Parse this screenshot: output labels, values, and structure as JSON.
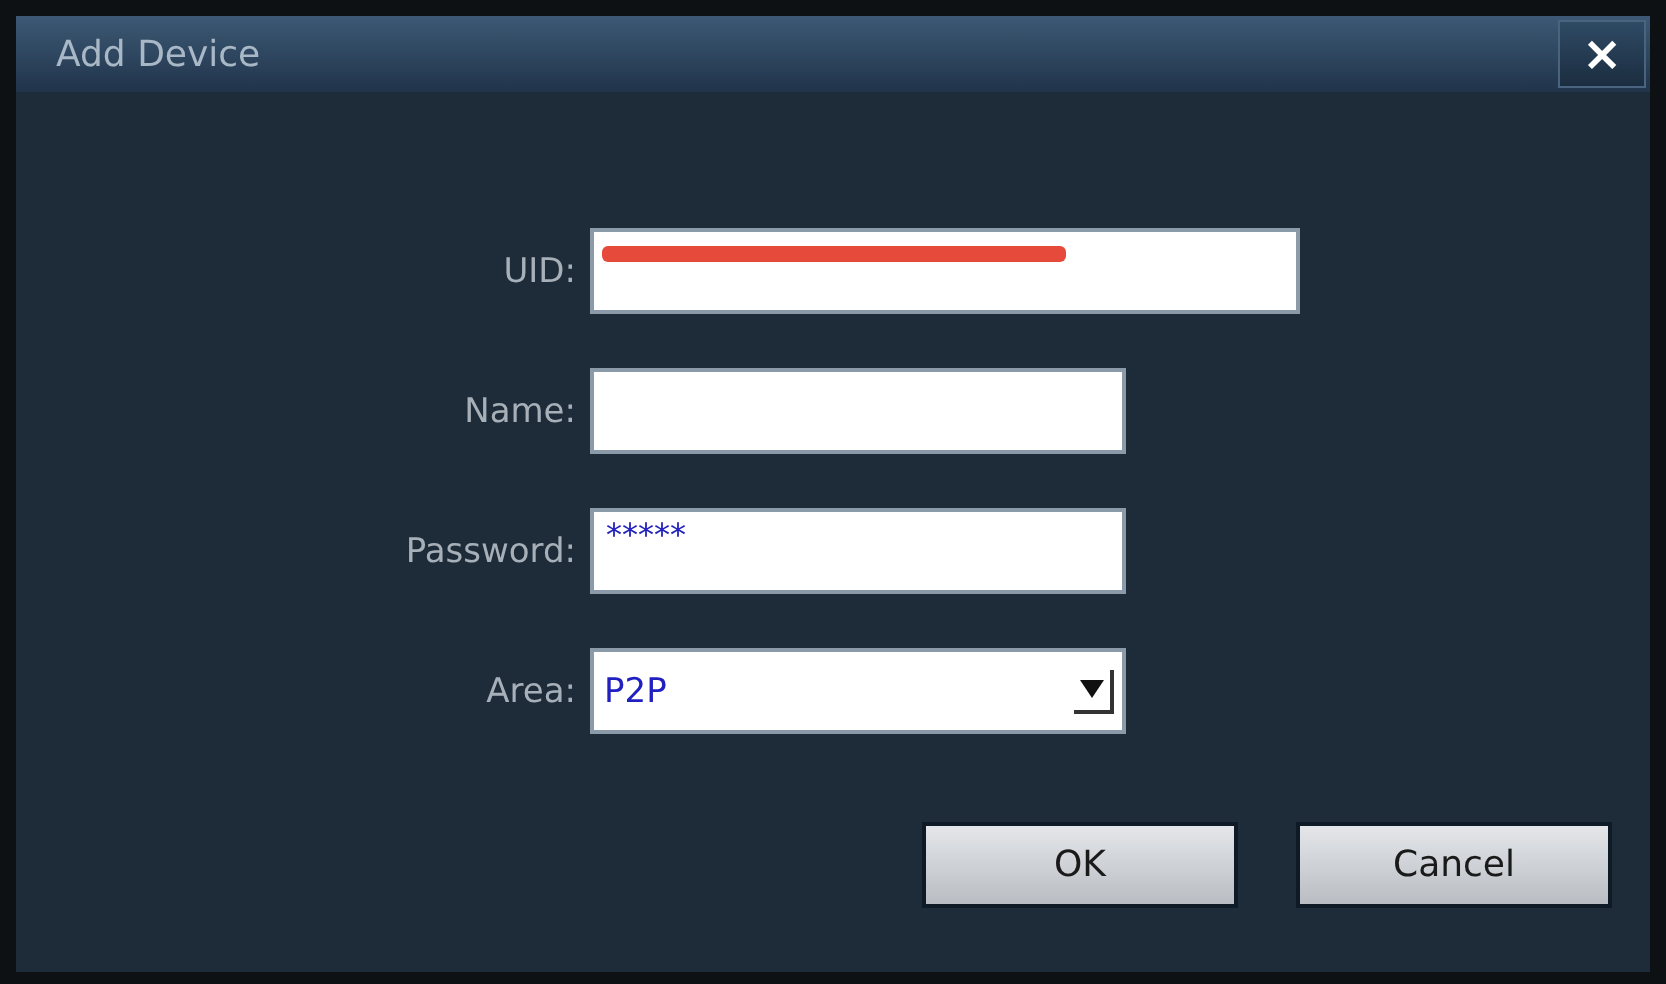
{
  "window": {
    "title": "Add Device",
    "close": "×"
  },
  "fields": [
    {
      "kind": "wide",
      "label": "UID:",
      "redacted": true
    },
    {
      "kind": "text",
      "label": "Name:"
    },
    {
      "kind": "text",
      "label": "Password:",
      "value": "*****"
    },
    {
      "kind": "dropdown",
      "label": "Area:",
      "value": "P2P"
    }
  ],
  "buttons": [
    "OK",
    "Cancel"
  ]
}
